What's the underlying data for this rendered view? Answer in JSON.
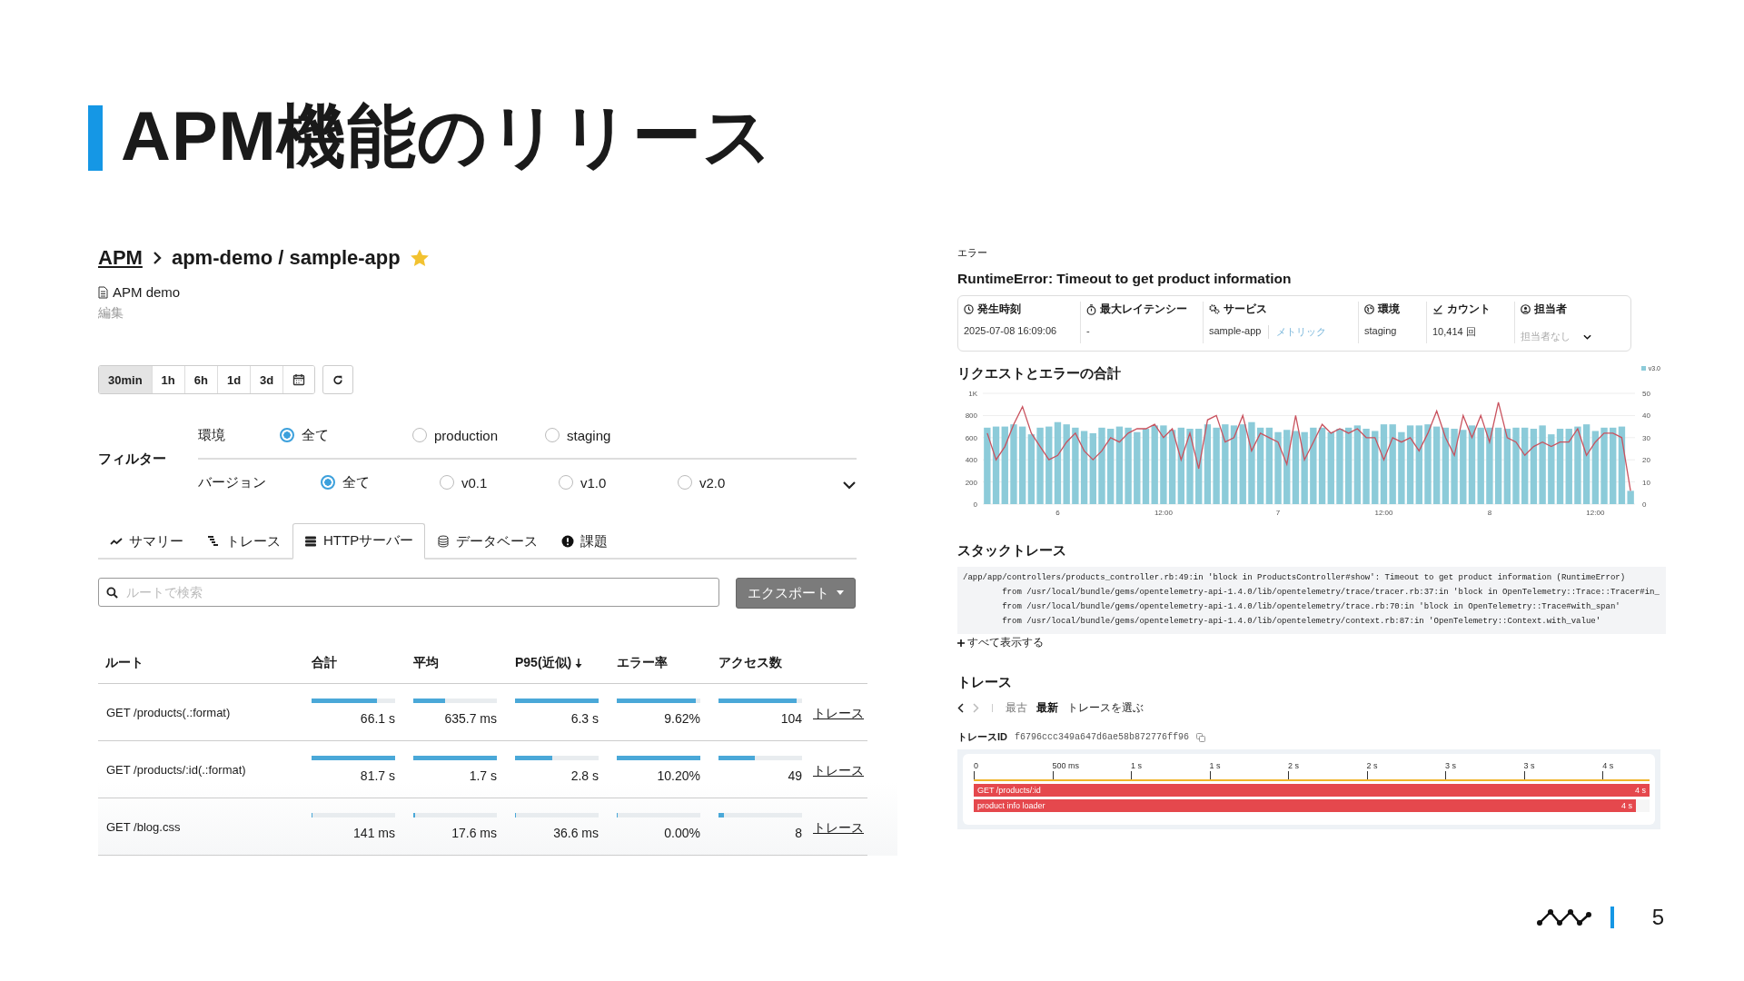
{
  "slide": {
    "title": "APM機能のリリース",
    "page_number": "5"
  },
  "app_page": {
    "breadcrumb": {
      "root": "APM",
      "path": "apm-demo / sample-app",
      "starred": true
    },
    "description": "APM demo",
    "edit_link": "編集",
    "time_ranges": [
      {
        "label": "30min",
        "selected": true
      },
      {
        "label": "1h",
        "selected": false
      },
      {
        "label": "6h",
        "selected": false
      },
      {
        "label": "1d",
        "selected": false
      },
      {
        "label": "3d",
        "selected": false
      }
    ],
    "filters": {
      "label": "フィルター",
      "groups": [
        {
          "label": "環境",
          "options": [
            {
              "label": "全て",
              "selected": true
            },
            {
              "label": "production",
              "selected": false
            },
            {
              "label": "staging",
              "selected": false
            }
          ]
        },
        {
          "label": "バージョン",
          "options": [
            {
              "label": "全て",
              "selected": true
            },
            {
              "label": "v0.1",
              "selected": false
            },
            {
              "label": "v1.0",
              "selected": false
            },
            {
              "label": "v2.0",
              "selected": false
            }
          ]
        }
      ]
    },
    "tabs": [
      {
        "label": "サマリー",
        "selected": false
      },
      {
        "label": "トレース",
        "selected": false
      },
      {
        "label": "HTTPサーバー",
        "selected": true
      },
      {
        "label": "データベース",
        "selected": false
      },
      {
        "label": "課題",
        "selected": false
      }
    ],
    "search": {
      "placeholder": "ルートで検索"
    },
    "export_button": "エクスポート",
    "table": {
      "columns": [
        {
          "label": "ルート",
          "sorted": false
        },
        {
          "label": "合計",
          "sorted": false
        },
        {
          "label": "平均",
          "sorted": false
        },
        {
          "label": "P95(近似)",
          "sorted": true
        },
        {
          "label": "エラー率",
          "sorted": false
        },
        {
          "label": "アクセス数",
          "sorted": false
        }
      ],
      "rows": [
        {
          "route": "GET /products(.:format)",
          "cells": [
            {
              "value": "66.1 s",
              "level": 0.78
            },
            {
              "value": "635.7 ms",
              "level": 0.38
            },
            {
              "value": "6.3 s",
              "level": 1.0
            },
            {
              "value": "9.62%",
              "level": 0.95
            },
            {
              "value": "104",
              "level": 0.93
            }
          ],
          "link": "トレース"
        },
        {
          "route": "GET /products/:id(.:format)",
          "cells": [
            {
              "value": "81.7 s",
              "level": 1.0
            },
            {
              "value": "1.7 s",
              "level": 1.0
            },
            {
              "value": "2.8 s",
              "level": 0.45
            },
            {
              "value": "10.20%",
              "level": 1.0
            },
            {
              "value": "49",
              "level": 0.43
            }
          ],
          "link": "トレース"
        },
        {
          "route": "GET /blog.css",
          "cells": [
            {
              "value": "141 ms",
              "level": 0.01
            },
            {
              "value": "17.6 ms",
              "level": 0.02
            },
            {
              "value": "36.6 ms",
              "level": 0.01
            },
            {
              "value": "0.00%",
              "level": 0
            },
            {
              "value": "8",
              "level": 0.07
            }
          ],
          "link": "トレース"
        }
      ]
    }
  },
  "error_page": {
    "label": "エラー",
    "title": "RuntimeError: Timeout to get product information",
    "details": [
      {
        "kind": "text",
        "label": "発生時刻",
        "value": "2025-07-08 16:09:06"
      },
      {
        "kind": "text",
        "label": "最大レイテンシー",
        "value": "-"
      },
      {
        "kind": "service",
        "label": "サービス",
        "value": "sample-app",
        "link": "メトリック"
      },
      {
        "kind": "text",
        "label": "環境",
        "value": "staging"
      },
      {
        "kind": "text",
        "label": "カウント",
        "value": "10,414 回"
      },
      {
        "kind": "select",
        "label": "担当者",
        "placeholder": "担当者なし"
      }
    ],
    "chart": {
      "chart_data": {
        "type": "bar",
        "title": "リクエストとエラーの合計",
        "grid": true,
        "ylim": [
          0,
          1000
        ],
        "yticks": [
          0,
          200,
          400,
          600,
          800,
          {
            "value": 1000,
            "label": "1K"
          }
        ],
        "y2lim": [
          0,
          50
        ],
        "y2ticks": [
          0,
          10,
          20,
          30,
          40,
          50
        ],
        "categories": [
          null,
          null,
          null,
          null,
          null,
          null,
          null,
          null,
          "6",
          null,
          null,
          null,
          null,
          null,
          null,
          null,
          null,
          null,
          null,
          null,
          "12:00",
          null,
          null,
          null,
          null,
          null,
          null,
          null,
          null,
          null,
          null,
          null,
          null,
          "7",
          null,
          null,
          null,
          null,
          null,
          null,
          null,
          null,
          null,
          null,
          null,
          "12:00",
          null,
          null,
          null,
          null,
          null,
          null,
          null,
          null,
          null,
          null,
          null,
          "8",
          null,
          null,
          null,
          null,
          null,
          null,
          null,
          null,
          null,
          null,
          null,
          "12:00",
          null,
          null,
          null,
          null
        ],
        "series": [
          {
            "name": "v3.0",
            "color": "#8ccbd9",
            "values": [
              690,
              700,
              700,
              720,
              700,
              630,
              690,
              700,
              740,
              720,
              690,
              660,
              640,
              690,
              680,
              700,
              690,
              650,
              680,
              710,
              710,
              670,
              690,
              680,
              680,
              720,
              690,
              720,
              710,
              720,
              740,
              690,
              690,
              650,
              670,
              660,
              650,
              690,
              690,
              650,
              680,
              690,
              710,
              680,
              660,
              720,
              720,
              650,
              710,
              710,
              720,
              700,
              690,
              680,
              670,
              710,
              690,
              690,
              690,
              680,
              690,
              690,
              680,
              710,
              630,
              680,
              680,
              700,
              720,
              660,
              690,
              690,
              700,
              120
            ]
          },
          {
            "type": "line",
            "axis": "y2",
            "color": "#c9525e",
            "values": [
              32,
              20,
              26,
              36,
              44,
              32,
              26,
              20,
              22,
              28,
              32,
              24,
              20,
              24,
              30,
              28,
              32,
              34,
              34,
              36,
              30,
              34,
              20,
              32,
              16,
              38,
              40,
              28,
              30,
              40,
              24,
              32,
              30,
              28,
              18,
              40,
              20,
              28,
              36,
              32,
              34,
              32,
              34,
              30,
              30,
              20,
              30,
              28,
              30,
              24,
              32,
              42,
              30,
              22,
              40,
              30,
              40,
              28,
              46,
              30,
              28,
              22,
              26,
              28,
              26,
              28,
              28,
              34,
              22,
              28,
              32,
              32,
              30,
              6
            ]
          }
        ]
      }
    },
    "stack_trace": {
      "title": "スタックトレース",
      "lines": [
        "/app/app/controllers/products_controller.rb:49:in 'block in ProductsController#show': Timeout to get product information (RuntimeError)",
        "        from /usr/local/bundle/gems/opentelemetry-api-1.4.0/lib/opentelemetry/trace/tracer.rb:37:in 'block in OpenTelemetry::Trace::Tracer#in_",
        "        from /usr/local/bundle/gems/opentelemetry-api-1.4.0/lib/opentelemetry/trace.rb:70:in 'block in OpenTelemetry::Trace#with_span'",
        "        from /usr/local/bundle/gems/opentelemetry-api-1.4.0/lib/opentelemetry/context.rb:87:in 'OpenTelemetry::Context.with_value'"
      ],
      "show_all": "すべて表示する"
    },
    "traces": {
      "title": "トレース",
      "order": [
        {
          "label": "最古",
          "selected": false
        },
        {
          "label": "最新",
          "selected": true
        }
      ],
      "pick": "トレースを選ぶ",
      "trace_id_label": "トレースID",
      "trace_id": "f6796ccc349a647d6ae58b872776ff96",
      "ticks": [
        "0",
        "500 ms",
        "1 s",
        "1 s",
        "2 s",
        "2 s",
        "3 s",
        "3 s",
        "4 s"
      ],
      "spans": [
        {
          "name": "GET /products/:id",
          "duration": "4 s",
          "level": 1.0
        },
        {
          "name": "product info loader",
          "duration": "4 s",
          "level": 0.98
        }
      ]
    }
  }
}
